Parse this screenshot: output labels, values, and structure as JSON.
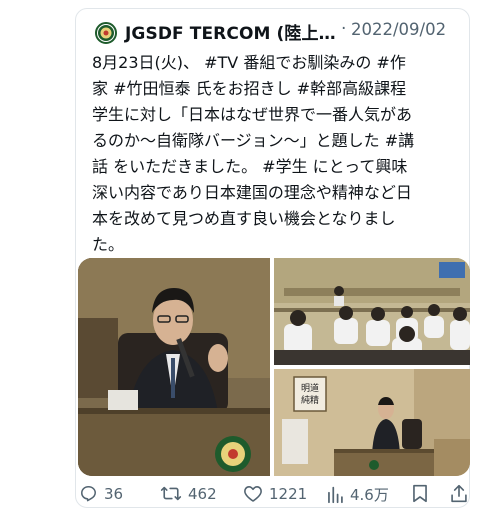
{
  "tweet": {
    "author": "JGSDF TERCOM (陸上…",
    "separator": "·",
    "date": "2022/09/02",
    "lines": [
      "8月23日(火)、 #TV 番組でお馴染みの #作",
      "家 #竹田恒泰 氏をお招きし #幹部高級課程",
      "学生に対し「日本はなぜ世界で一番人気があ",
      "るのか〜自衛隊バージョン〜」と題した #講",
      "話 をいただきました。 #学生 にとって興味",
      "深い内容であり日本建国の理念や精神など日",
      "本を改めて見つめ直す良い機会となりまし",
      "た。"
    ]
  },
  "photo3_sign": "明道と純精",
  "actions": {
    "replies": "36",
    "retweets": "462",
    "likes": "1221",
    "views": "4.6万"
  },
  "icons": [
    "reply-icon",
    "retweet-icon",
    "like-icon",
    "views-icon",
    "bookmark-icon",
    "share-icon"
  ],
  "colors": {
    "text": "#0f1419",
    "muted": "#536471",
    "emblem": "#1e5b2c"
  }
}
